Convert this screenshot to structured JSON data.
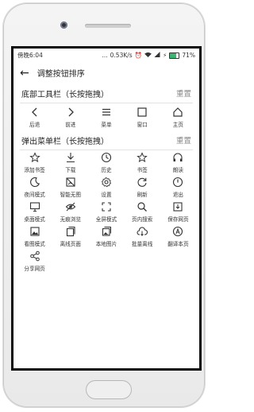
{
  "status": {
    "left": "傍晚6:04",
    "dots": "...",
    "speed": "0.53K/s",
    "battery": "71%"
  },
  "appbar": {
    "title": "调整按钮排序"
  },
  "toolbar_section": {
    "title": "底部工具栏（长按拖拽）",
    "reset": "重置"
  },
  "toolbar_items": [
    {
      "label": "后退",
      "icon": "chevron-left-icon"
    },
    {
      "label": "前进",
      "icon": "chevron-right-icon"
    },
    {
      "label": "菜单",
      "icon": "menu-icon"
    },
    {
      "label": "窗口",
      "icon": "window-icon"
    },
    {
      "label": "主页",
      "icon": "home-icon"
    }
  ],
  "menu_section": {
    "title": "弹出菜单栏（长按拖拽）",
    "reset": "重置"
  },
  "menu_items": [
    {
      "label": "添加书签",
      "icon": "star-add-icon"
    },
    {
      "label": "下载",
      "icon": "download-icon"
    },
    {
      "label": "历史",
      "icon": "clock-icon"
    },
    {
      "label": "书签",
      "icon": "star-icon"
    },
    {
      "label": "朗读",
      "icon": "headphones-icon"
    },
    {
      "label": "夜间模式",
      "icon": "moon-icon"
    },
    {
      "label": "智能无图",
      "icon": "no-image-icon"
    },
    {
      "label": "设置",
      "icon": "gear-icon"
    },
    {
      "label": "刷新",
      "icon": "refresh-icon"
    },
    {
      "label": "退出",
      "icon": "power-icon"
    },
    {
      "label": "桌面模式",
      "icon": "desktop-icon"
    },
    {
      "label": "无痕浏览",
      "icon": "incognito-icon"
    },
    {
      "label": "全屏模式",
      "icon": "fullscreen-icon"
    },
    {
      "label": "页内搜索",
      "icon": "search-icon"
    },
    {
      "label": "保存网页",
      "icon": "save-page-icon"
    },
    {
      "label": "看图模式",
      "icon": "picture-icon"
    },
    {
      "label": "离线页面",
      "icon": "offline-page-icon"
    },
    {
      "label": "本地图片",
      "icon": "local-pictures-icon"
    },
    {
      "label": "批量离线",
      "icon": "cloud-download-icon"
    },
    {
      "label": "翻译本页",
      "icon": "translate-icon"
    },
    {
      "label": "分享网页",
      "icon": "share-icon"
    }
  ]
}
